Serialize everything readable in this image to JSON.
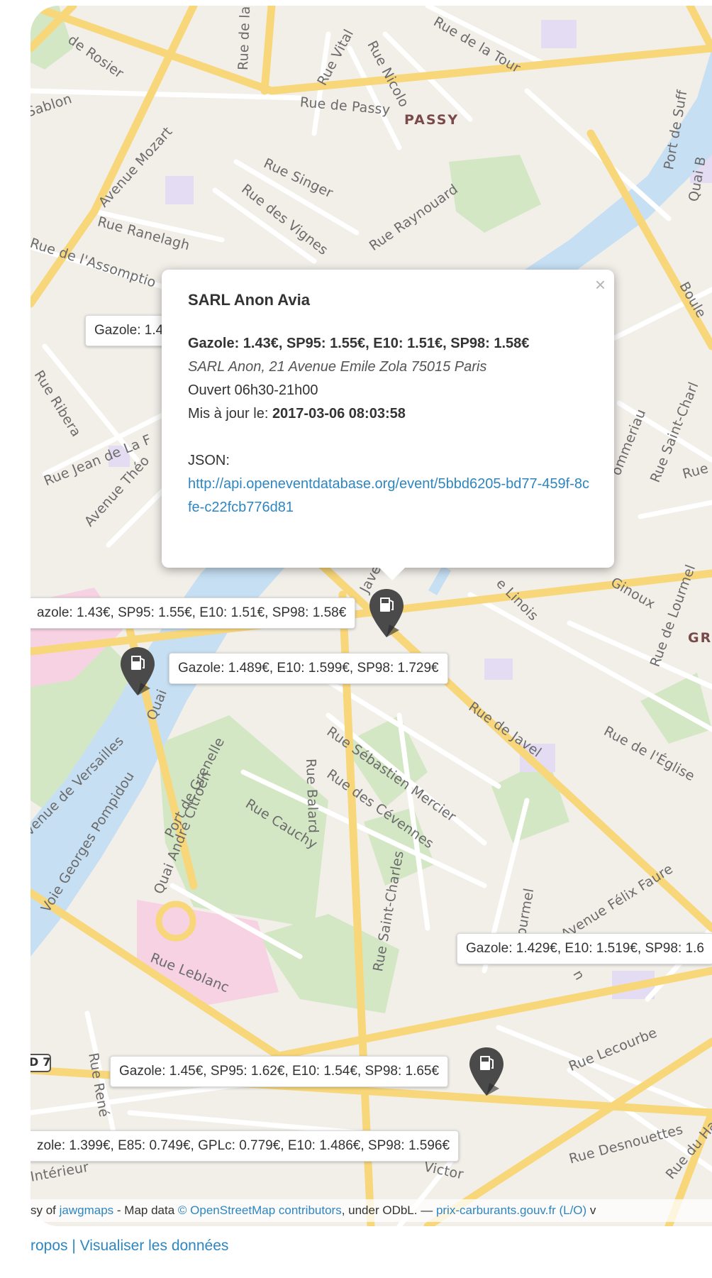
{
  "map": {
    "district_labels": [
      "PASSY",
      "GR"
    ],
    "road_shield": "D 7",
    "street_labels": [
      "Rue de Passy",
      "Rue Vital",
      "Rue Nicolo",
      "Rue de la Tour",
      "Rue de la",
      "de Rosier",
      "Sablon",
      "Avenue Mozart",
      "Rue Singer",
      "Rue des Vignes",
      "Rue Raynouard",
      "Rue Ranelagh",
      "Rue de l'Assomptio",
      "Rue Ribera",
      "Rue Jean de La F",
      "Avenue Théo",
      "Port de Suff",
      "Quai B",
      "Boule",
      "Rue Saint-Charl",
      "Rue",
      "ommeriau",
      "Ginoux",
      "Rue de Lourmel",
      "e Linois",
      "Javel",
      "Rue de Javel",
      "Rue de l'Église",
      "Rue Sébastien Mercier",
      "Rue des Cévennes",
      "Rue Balard",
      "Rue Cauchy",
      "Port de Grenelle",
      "Quai André Citroën",
      "venue de Versailles",
      "Voie Georges Pompidou",
      "Quai",
      "Rue Saint-Charles",
      "Lourmel",
      "Avenue Félix Faure",
      "Rue Leblanc",
      "Rue Lecourbe",
      "Rue René",
      "Rue Desnouettes",
      "Intérieur",
      "Victor",
      "Rue du Hameau",
      "n"
    ]
  },
  "price_tags": [
    "Gazole: 1.4",
    "azole: 1.43€, SP95: 1.55€, E10: 1.51€, SP98: 1.58€",
    "Gazole: 1.489€, E10: 1.599€, SP98: 1.729€",
    "Gazole: 1.429€, E10: 1.519€, SP98: 1.6",
    "Gazole: 1.45€, SP95: 1.62€, E10: 1.54€, SP98: 1.65€",
    "zole: 1.399€, E85: 0.749€, GPLc: 0.779€, E10: 1.486€, SP98: 1.596€"
  ],
  "popup": {
    "close": "×",
    "name": "SARL Anon Avia",
    "prices": "Gazole: 1.43€, SP95: 1.55€, E10: 1.51€, SP98: 1.58€",
    "address": "SARL Anon, 21 Avenue Emile Zola 75015 Paris",
    "hours": "Ouvert 06h30-21h00",
    "updated_label": "Mis à jour le: ",
    "updated_value": "2017-03-06 08:03:58",
    "json_label": "JSON:",
    "json_link": "http://api.openeventdatabase.org/event/5bbd6205-bd77-459f-8cfe-c22fcb776d81"
  },
  "attribution": {
    "prefix": "sy of ",
    "jawg": "jawgmaps",
    "mid": " - Map data ",
    "osm": "© OpenStreetMap contributors",
    "odbl": ", under ODbL. — ",
    "prix": "prix-carburants.gouv.fr (L/O)",
    "suffix": " v"
  },
  "footer": {
    "apropos": "ropos",
    "separator": " | ",
    "visualiser": "Visualiser les données"
  },
  "colors": {
    "water": "#c6dff3",
    "park": "#d4e7c5",
    "pink": "#f6d2e3",
    "road_major": "#f8d77a",
    "road_minor": "#ffffff",
    "link": "#2e86c1",
    "marker": "#4a4a4a"
  }
}
